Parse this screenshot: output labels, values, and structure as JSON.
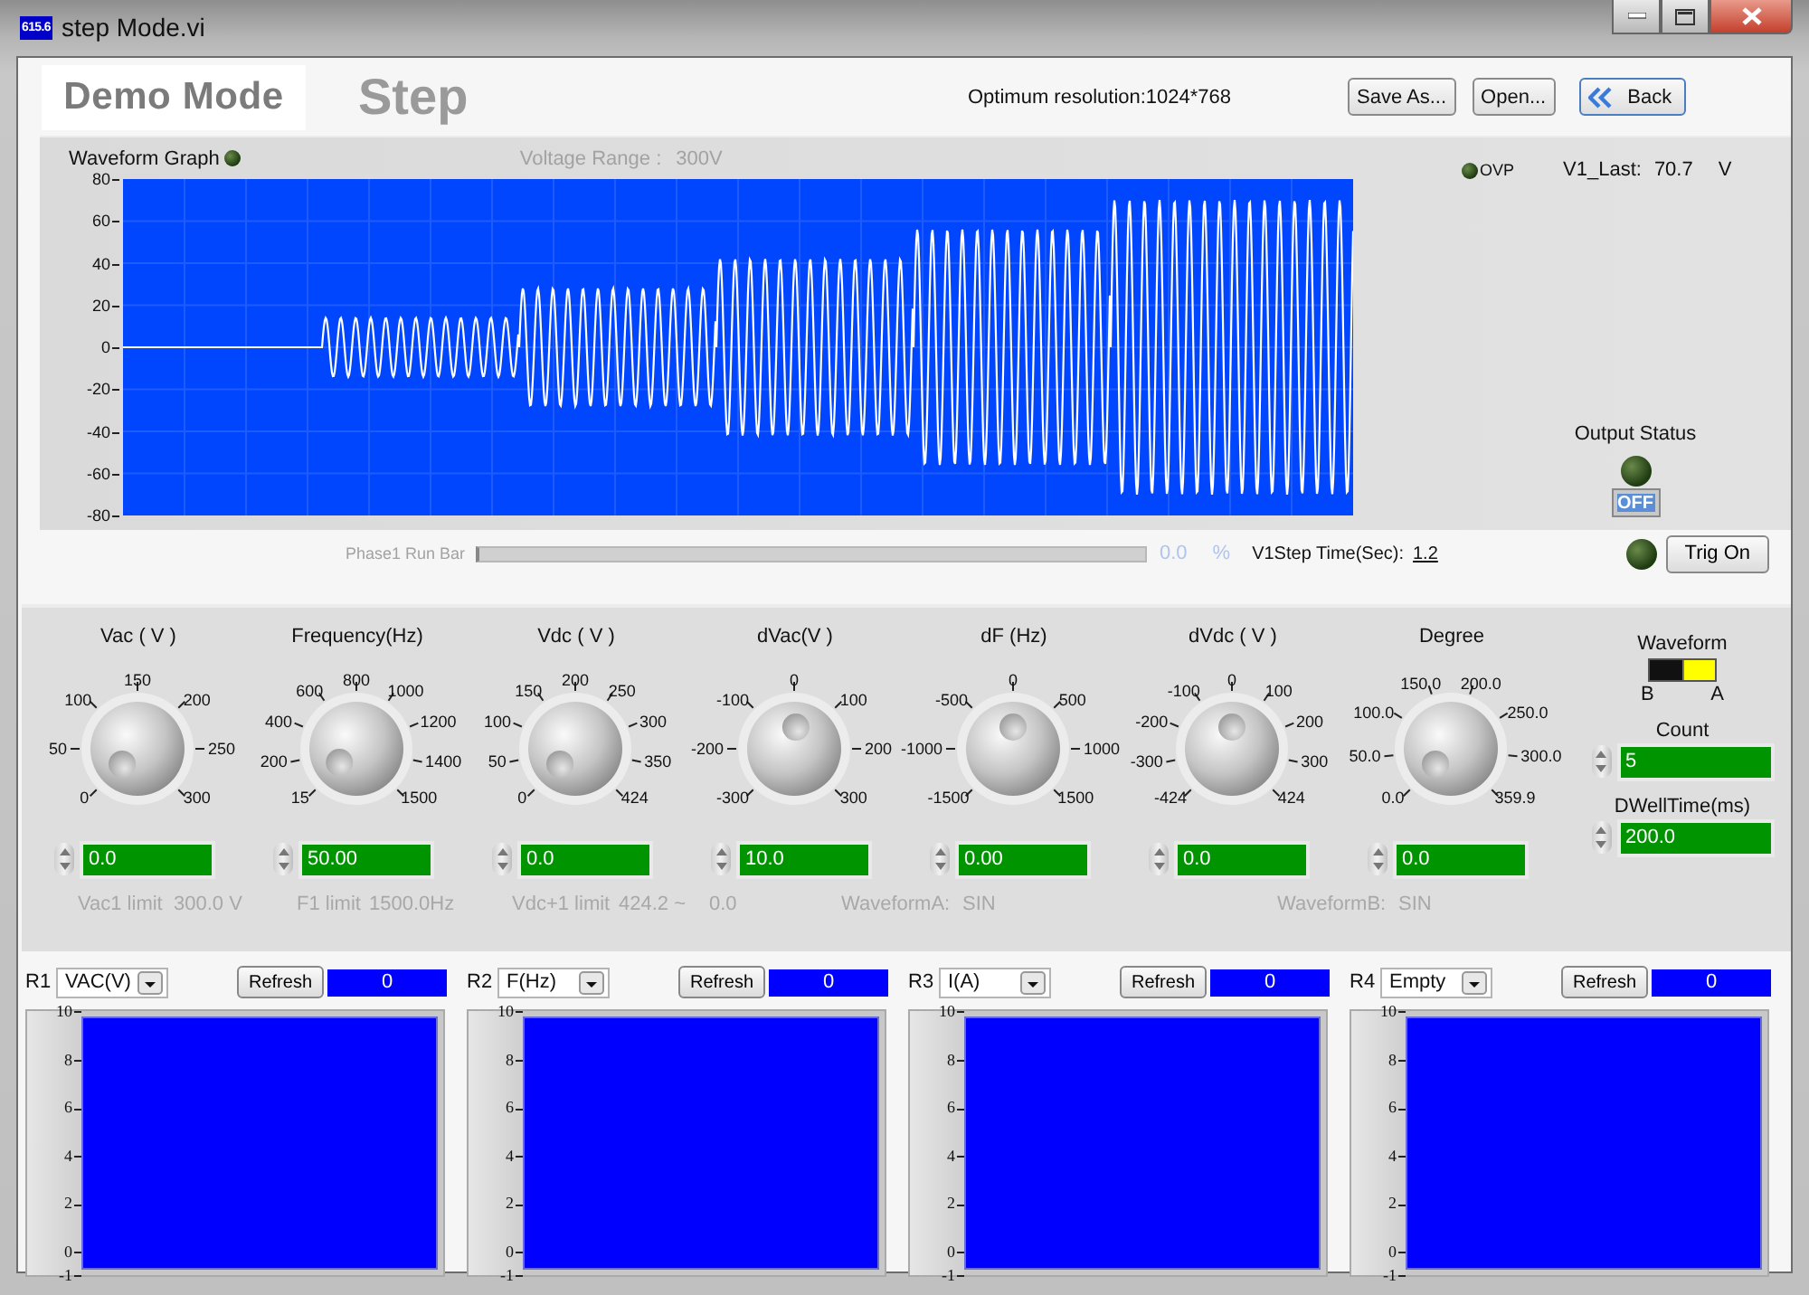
{
  "window": {
    "icon_text": "615.6",
    "title": "step Mode.vi"
  },
  "header": {
    "mode": "Demo Mode",
    "page": "Step",
    "resolution_note": "Optimum resolution:1024*768",
    "buttons": [
      {
        "label": "Save As...",
        "kind": "plain"
      },
      {
        "label": "Open...",
        "kind": "plain"
      },
      {
        "label": "Back",
        "kind": "back"
      }
    ]
  },
  "waveform_graph": {
    "title": "Waveform Graph",
    "led_on": false,
    "voltage_range_label": "Voltage Range :",
    "voltage_range": "300V",
    "y_axis_labels": [
      "80",
      "60",
      "40",
      "20",
      "0",
      "-20",
      "-40",
      "-60",
      "-80"
    ],
    "ovp": {
      "label": "OVP",
      "on": false
    },
    "v1_last": {
      "label": "V1_Last:",
      "value": "70.7",
      "unit": "V"
    },
    "output_status": {
      "label": "Output Status",
      "on": false,
      "button": "OFF"
    }
  },
  "run_bar": {
    "label": "Phase1 Run Bar",
    "level": 0,
    "percent": "0.0",
    "percent_unit": "%",
    "step_time_label": "V1Step Time(Sec):",
    "step_time": "1.2",
    "trig_led_on": false,
    "trig_button": "Trig On"
  },
  "knobs": [
    {
      "title": "Vac ( V )",
      "scale": [
        "0",
        "50",
        "100",
        "150",
        "200",
        "250",
        "300"
      ],
      "value": "0.0"
    },
    {
      "title": "Frequency(Hz)",
      "scale": [
        "15",
        "200",
        "400",
        "600",
        "800",
        "1000",
        "1200",
        "1400",
        "1500"
      ],
      "value": "50.00"
    },
    {
      "title": "Vdc ( V )",
      "scale": [
        "0",
        "50",
        "100",
        "150",
        "200",
        "250",
        "300",
        "350",
        "424"
      ],
      "value": "0.0"
    },
    {
      "title": "dVac(V )",
      "scale": [
        "-300",
        "-200",
        "-100",
        "0",
        "100",
        "200",
        "300"
      ],
      "value": "10.0"
    },
    {
      "title": "dF (Hz)",
      "scale": [
        "-1500",
        "-1000",
        "-500",
        "0",
        "500",
        "1000",
        "1500"
      ],
      "value": "0.00"
    },
    {
      "title": "dVdc ( V )",
      "scale": [
        "-424",
        "-300",
        "-200",
        "-100",
        "0",
        "100",
        "200",
        "300",
        "424"
      ],
      "value": "0.0"
    },
    {
      "title": "Degree",
      "scale": [
        "0.0",
        "50.0",
        "100.0",
        "150.0",
        "200.0",
        "250.0",
        "300.0",
        "359.9"
      ],
      "value": "0.0"
    }
  ],
  "limits": [
    "Vac1 limit",
    "300.0 V",
    "F1 limit",
    "1500.0Hz",
    "Vdc+1 limit",
    "424.2 ~",
    "0.0",
    "WaveformA:",
    "SIN",
    "WaveformB:",
    "SIN"
  ],
  "waveform_select": {
    "title": "Waveform",
    "left_label": "B",
    "right_label": "A",
    "a_selected": true
  },
  "count": {
    "label": "Count",
    "value": "5"
  },
  "dwell": {
    "label": "DWellTime(ms)",
    "value": "200.0"
  },
  "readouts": [
    {
      "name": "R1",
      "quantity": "VAC(V)",
      "button": "Refresh",
      "value": "0",
      "y_axis_labels": [
        "10",
        "8",
        "6",
        "4",
        "2",
        "0",
        "-1"
      ]
    },
    {
      "name": "R2",
      "quantity": "F(Hz)",
      "button": "Refresh",
      "value": "0",
      "y_axis_labels": [
        "10",
        "8",
        "6",
        "4",
        "2",
        "0",
        "-1"
      ]
    },
    {
      "name": "R3",
      "quantity": "I(A)",
      "button": "Refresh",
      "value": "0",
      "y_axis_labels": [
        "10",
        "8",
        "6",
        "4",
        "2",
        "0",
        "-1"
      ]
    },
    {
      "name": "R4",
      "quantity": "Empty",
      "button": "Refresh",
      "value": "0",
      "y_axis_labels": [
        "10",
        "8",
        "6",
        "4",
        "2",
        "0",
        "-1"
      ]
    }
  ]
}
